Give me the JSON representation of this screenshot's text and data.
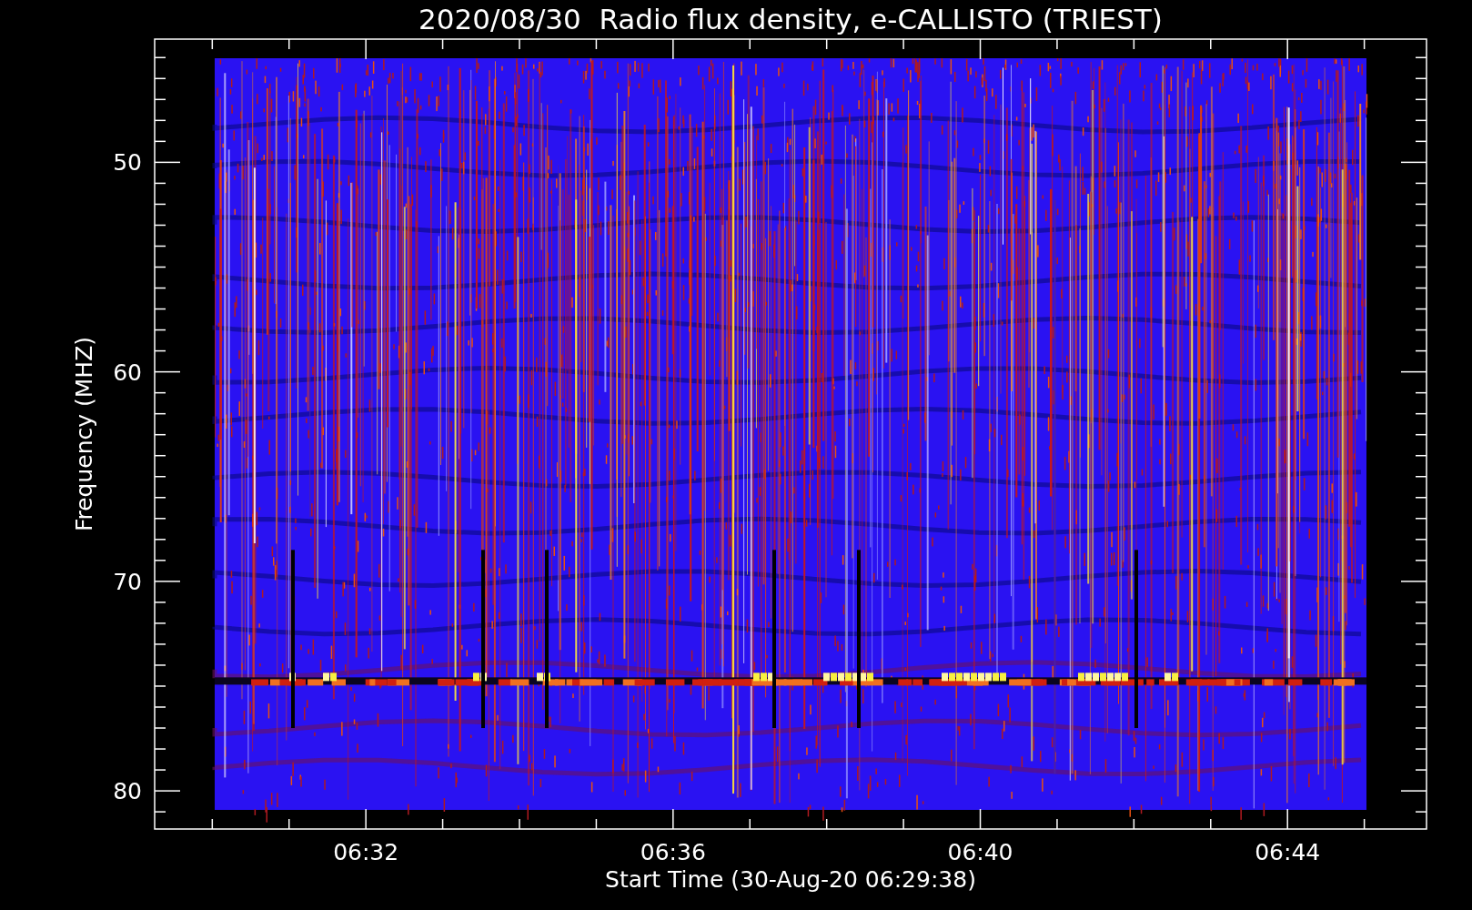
{
  "plot": {
    "title": "2020/08/30  Radio flux density, e-CALLISTO (TRIEST)",
    "y_axis": {
      "title": "Frequency (MHZ)",
      "tick_labels": [
        "50",
        "60",
        "70",
        "80"
      ]
    },
    "x_axis": {
      "title": "Start Time (30-Aug-20 06:29:38)",
      "tick_labels": [
        "06:32",
        "06:36",
        "06:40",
        "06:44"
      ]
    }
  }
}
